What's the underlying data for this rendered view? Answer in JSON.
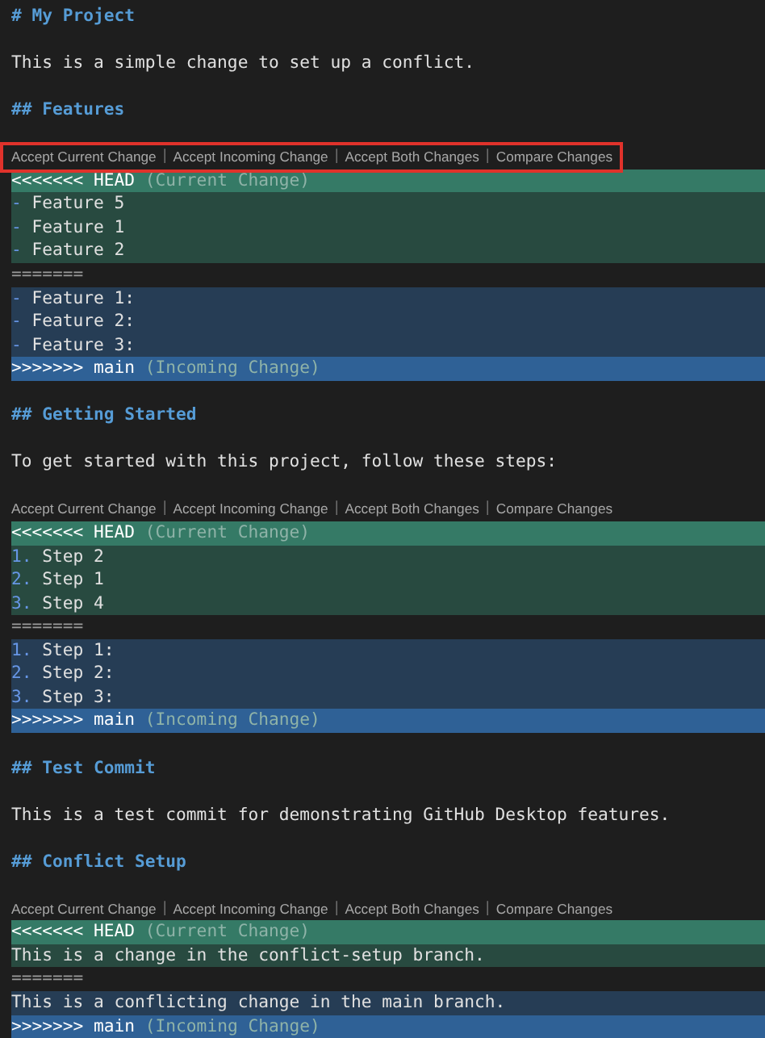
{
  "editor": {
    "lines": [
      {
        "kind": "heading",
        "text": "# My Project"
      },
      {
        "kind": "blank"
      },
      {
        "kind": "text",
        "text": "This is a simple change to set up a conflict."
      },
      {
        "kind": "blank"
      },
      {
        "kind": "heading",
        "text": "## Features"
      },
      {
        "kind": "blank"
      },
      {
        "kind": "codelens",
        "highlighted": true,
        "items": [
          {
            "kind": "action",
            "text": "Accept Current Change"
          },
          {
            "kind": "divider",
            "text": "|"
          },
          {
            "kind": "action",
            "text": "Accept Incoming Change"
          },
          {
            "kind": "divider",
            "text": "|"
          },
          {
            "kind": "action",
            "text": "Accept Both Changes"
          },
          {
            "kind": "divider",
            "text": "|"
          },
          {
            "kind": "action",
            "text": "Compare Changes"
          }
        ]
      },
      {
        "kind": "current_marker",
        "marker": "<<<<<<< HEAD",
        "note": "(Current Change)"
      },
      {
        "kind": "current",
        "bullet": "-",
        "text": "Feature 5"
      },
      {
        "kind": "current",
        "bullet": "-",
        "text": "Feature 1"
      },
      {
        "kind": "current",
        "bullet": "-",
        "text": "Feature 2"
      },
      {
        "kind": "separator",
        "text": "======="
      },
      {
        "kind": "incoming",
        "bullet": "-",
        "text": "Feature 1:"
      },
      {
        "kind": "incoming",
        "bullet": "-",
        "text": "Feature 2:"
      },
      {
        "kind": "incoming",
        "bullet": "-",
        "text": "Feature 3:"
      },
      {
        "kind": "incoming_marker",
        "marker": ">>>>>>> main",
        "note": "(Incoming Change)"
      },
      {
        "kind": "blank"
      },
      {
        "kind": "heading",
        "text": "## Getting Started"
      },
      {
        "kind": "blank"
      },
      {
        "kind": "text",
        "text": "To get started with this project, follow these steps:"
      },
      {
        "kind": "blank"
      },
      {
        "kind": "codelens",
        "highlighted": false,
        "items": [
          {
            "kind": "action",
            "text": "Accept Current Change"
          },
          {
            "kind": "divider",
            "text": "|"
          },
          {
            "kind": "action",
            "text": "Accept Incoming Change"
          },
          {
            "kind": "divider",
            "text": "|"
          },
          {
            "kind": "action",
            "text": "Accept Both Changes"
          },
          {
            "kind": "divider",
            "text": "|"
          },
          {
            "kind": "action",
            "text": "Compare Changes"
          }
        ]
      },
      {
        "kind": "current_marker",
        "marker": "<<<<<<< HEAD",
        "note": "(Current Change)"
      },
      {
        "kind": "current",
        "bullet": "1.",
        "text": "Step 2"
      },
      {
        "kind": "current",
        "bullet": "2.",
        "text": "Step 1"
      },
      {
        "kind": "current",
        "bullet": "3.",
        "text": "Step 4"
      },
      {
        "kind": "separator",
        "text": "======="
      },
      {
        "kind": "incoming",
        "bullet": "1.",
        "text": "Step 1:"
      },
      {
        "kind": "incoming",
        "bullet": "2.",
        "text": "Step 2:"
      },
      {
        "kind": "incoming",
        "bullet": "3.",
        "text": "Step 3:"
      },
      {
        "kind": "incoming_marker",
        "marker": ">>>>>>> main",
        "note": "(Incoming Change)"
      },
      {
        "kind": "blank"
      },
      {
        "kind": "heading",
        "text": "## Test Commit"
      },
      {
        "kind": "blank"
      },
      {
        "kind": "text",
        "text": "This is a test commit for demonstrating GitHub Desktop features."
      },
      {
        "kind": "blank"
      },
      {
        "kind": "heading",
        "text": "## Conflict Setup"
      },
      {
        "kind": "blank"
      },
      {
        "kind": "codelens",
        "highlighted": false,
        "items": [
          {
            "kind": "action",
            "text": "Accept Current Change"
          },
          {
            "kind": "divider",
            "text": "|"
          },
          {
            "kind": "action",
            "text": "Accept Incoming Change"
          },
          {
            "kind": "divider",
            "text": "|"
          },
          {
            "kind": "action",
            "text": "Accept Both Changes"
          },
          {
            "kind": "divider",
            "text": "|"
          },
          {
            "kind": "action",
            "text": "Compare Changes"
          }
        ]
      },
      {
        "kind": "current_marker",
        "marker": "<<<<<<< HEAD",
        "note": "(Current Change)"
      },
      {
        "kind": "current",
        "text": "This is a change in the conflict-setup branch."
      },
      {
        "kind": "separator",
        "text": "======="
      },
      {
        "kind": "incoming",
        "text": "This is a conflicting change in the main branch."
      },
      {
        "kind": "incoming_marker",
        "marker": ">>>>>>> main",
        "note": "(Incoming Change)"
      }
    ]
  }
}
